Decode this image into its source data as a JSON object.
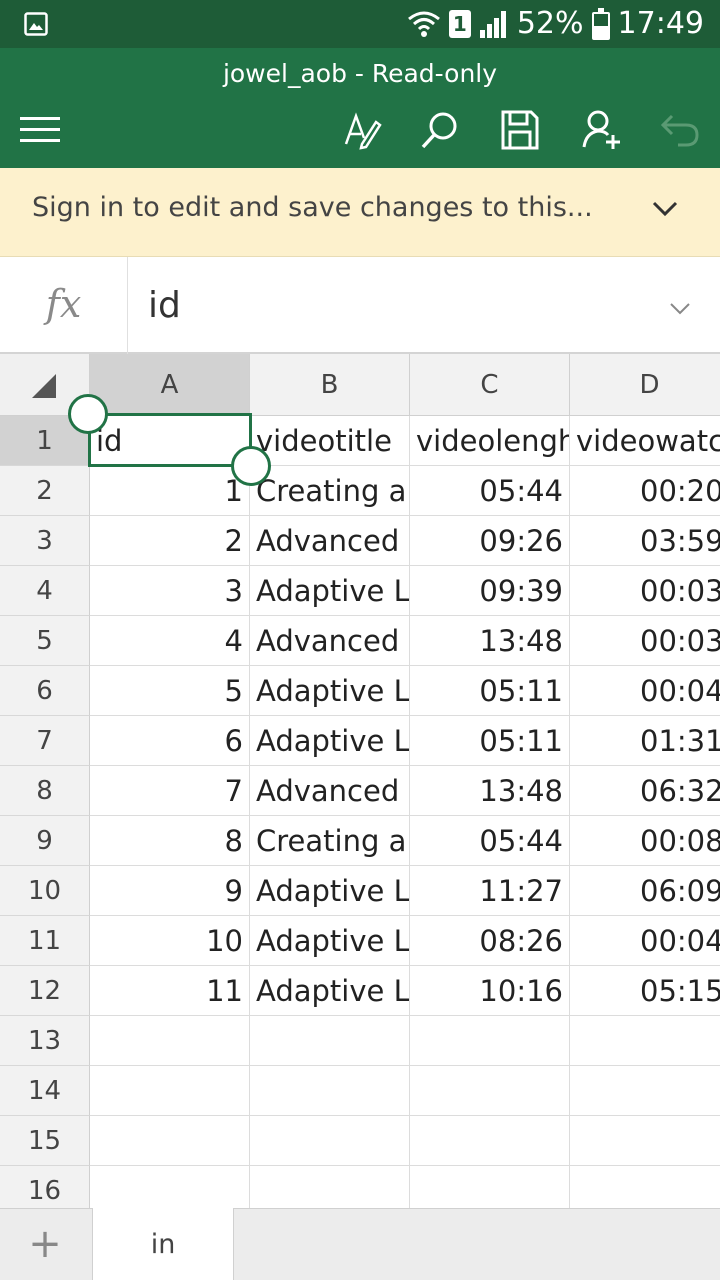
{
  "status_bar": {
    "sim_label": "1",
    "battery": "52%",
    "time": "17:49",
    "battery_level": 0.52
  },
  "app_bar": {
    "title": "jowel_aob - Read-only"
  },
  "banner": {
    "message": "Sign in to edit and save changes to this..."
  },
  "formula_bar": {
    "fx_label": "fx",
    "value": "id"
  },
  "sheet": {
    "columns": [
      "A",
      "B",
      "C",
      "D"
    ],
    "selected_column": "A",
    "selected_row": "1",
    "rows": [
      {
        "num": "1",
        "a": "id",
        "b": "videotitle",
        "c": "videolengh",
        "d": "videowatc"
      },
      {
        "num": "2",
        "a": "1",
        "b": "Creating a",
        "c": "05:44",
        "d": "00:20"
      },
      {
        "num": "3",
        "a": "2",
        "b": "Advanced",
        "c": "09:26",
        "d": "03:59"
      },
      {
        "num": "4",
        "a": "3",
        "b": "Adaptive L",
        "c": "09:39",
        "d": "00:03"
      },
      {
        "num": "5",
        "a": "4",
        "b": "Advanced",
        "c": "13:48",
        "d": "00:03"
      },
      {
        "num": "6",
        "a": "5",
        "b": "Adaptive L",
        "c": "05:11",
        "d": "00:04"
      },
      {
        "num": "7",
        "a": "6",
        "b": "Adaptive L",
        "c": "05:11",
        "d": "01:31"
      },
      {
        "num": "8",
        "a": "7",
        "b": "Advanced",
        "c": "13:48",
        "d": "06:32"
      },
      {
        "num": "9",
        "a": "8",
        "b": "Creating a",
        "c": "05:44",
        "d": "00:08"
      },
      {
        "num": "10",
        "a": "9",
        "b": "Adaptive L",
        "c": "11:27",
        "d": "06:09"
      },
      {
        "num": "11",
        "a": "10",
        "b": "Adaptive L",
        "c": "08:26",
        "d": "00:04"
      },
      {
        "num": "12",
        "a": "11",
        "b": "Adaptive L",
        "c": "10:16",
        "d": "05:15"
      },
      {
        "num": "13",
        "a": "",
        "b": "",
        "c": "",
        "d": ""
      },
      {
        "num": "14",
        "a": "",
        "b": "",
        "c": "",
        "d": ""
      },
      {
        "num": "15",
        "a": "",
        "b": "",
        "c": "",
        "d": ""
      },
      {
        "num": "16",
        "a": "",
        "b": "",
        "c": "",
        "d": ""
      }
    ]
  },
  "tabs": {
    "add_label": "+",
    "items": [
      {
        "label": "in"
      }
    ]
  },
  "colors": {
    "status": "#1e5c37",
    "accent": "#217346",
    "banner": "#fdf1cd"
  },
  "icons": [
    "gallery-icon",
    "wifi-icon",
    "signal-icon",
    "battery-icon",
    "menu-icon",
    "draw-icon",
    "search-icon",
    "save-icon",
    "share-person-icon",
    "undo-icon",
    "chevron-down-icon",
    "select-all-icon"
  ]
}
